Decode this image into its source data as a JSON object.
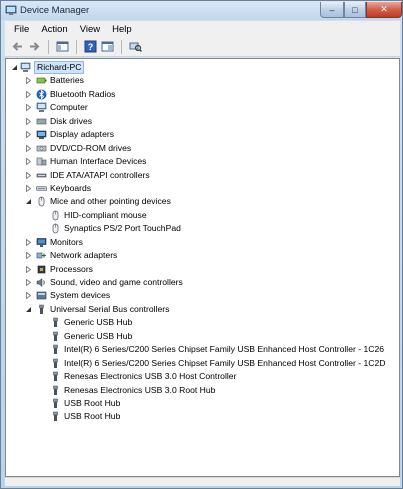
{
  "window": {
    "title": "Device Manager",
    "caption_buttons": {
      "minimize": "–",
      "maximize": "□",
      "close": "✕"
    }
  },
  "menu": [
    {
      "label": "File"
    },
    {
      "label": "Action"
    },
    {
      "label": "View"
    },
    {
      "label": "Help"
    }
  ],
  "toolbar": {
    "buttons": [
      "back-arrow-icon",
      "forward-arrow-icon",
      "properties-pane-icon",
      "help-icon",
      "console-tree-icon",
      "scan-hardware-icon"
    ]
  },
  "tree": {
    "root": {
      "label": "Richard-PC",
      "icon": "computer-icon",
      "expanded": true
    },
    "categories": [
      {
        "label": "Batteries",
        "icon": "battery-icon",
        "expanded": false
      },
      {
        "label": "Bluetooth Radios",
        "icon": "bluetooth-icon",
        "expanded": false
      },
      {
        "label": "Computer",
        "icon": "computer-icon",
        "expanded": false
      },
      {
        "label": "Disk drives",
        "icon": "disk-drive-icon",
        "expanded": false
      },
      {
        "label": "Display adapters",
        "icon": "display-adapter-icon",
        "expanded": false
      },
      {
        "label": "DVD/CD-ROM drives",
        "icon": "dvd-drive-icon",
        "expanded": false
      },
      {
        "label": "Human Interface Devices",
        "icon": "hid-icon",
        "expanded": false
      },
      {
        "label": "IDE ATA/ATAPI controllers",
        "icon": "ide-controller-icon",
        "expanded": false
      },
      {
        "label": "Keyboards",
        "icon": "keyboard-icon",
        "expanded": false
      },
      {
        "label": "Mice and other pointing devices",
        "icon": "mouse-icon",
        "expanded": true,
        "children": [
          {
            "label": "HID-compliant mouse",
            "icon": "mouse-icon"
          },
          {
            "label": "Synaptics PS/2 Port TouchPad",
            "icon": "mouse-icon"
          }
        ]
      },
      {
        "label": "Monitors",
        "icon": "monitor-icon",
        "expanded": false
      },
      {
        "label": "Network adapters",
        "icon": "network-adapter-icon",
        "expanded": false
      },
      {
        "label": "Processors",
        "icon": "processor-icon",
        "expanded": false
      },
      {
        "label": "Sound, video and game controllers",
        "icon": "sound-icon",
        "expanded": false
      },
      {
        "label": "System devices",
        "icon": "system-devices-icon",
        "expanded": false
      },
      {
        "label": "Universal Serial Bus controllers",
        "icon": "usb-icon",
        "expanded": true,
        "children": [
          {
            "label": "Generic USB Hub",
            "icon": "usb-icon"
          },
          {
            "label": "Generic USB Hub",
            "icon": "usb-icon"
          },
          {
            "label": "Intel(R) 6 Series/C200 Series Chipset Family USB Enhanced Host Controller - 1C26",
            "icon": "usb-icon"
          },
          {
            "label": "Intel(R) 6 Series/C200 Series Chipset Family USB Enhanced Host Controller - 1C2D",
            "icon": "usb-icon"
          },
          {
            "label": "Renesas Electronics USB 3.0 Host Controller",
            "icon": "usb-icon"
          },
          {
            "label": "Renesas Electronics USB 3.0 Root Hub",
            "icon": "usb-icon"
          },
          {
            "label": "USB Root Hub",
            "icon": "usb-icon"
          },
          {
            "label": "USB Root Hub",
            "icon": "usb-icon"
          }
        ]
      }
    ]
  }
}
